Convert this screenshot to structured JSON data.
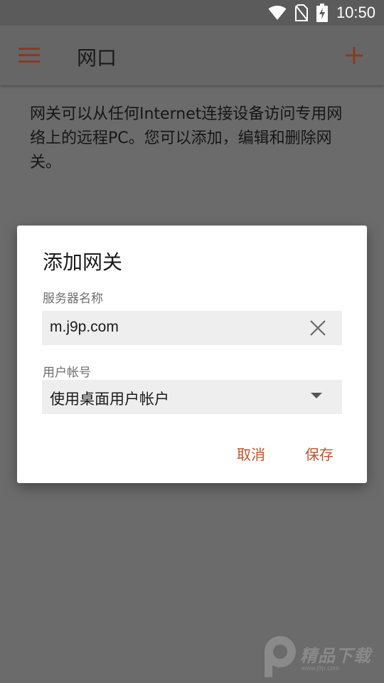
{
  "status_bar": {
    "time": "10:50",
    "icons": [
      "wifi-icon",
      "no-sim-icon",
      "battery-charging-icon"
    ]
  },
  "app_bar": {
    "title": "网口",
    "menu_icon": "hamburger-menu-icon",
    "add_icon": "plus-icon"
  },
  "main": {
    "description": "网关可以从任何Internet连接设备访问专用网络上的远程PC。您可以添加，编辑和删除网关。"
  },
  "dialog": {
    "title": "添加网关",
    "server_name": {
      "label": "服务器名称",
      "value": "m.j9p.com",
      "clear_icon": "close-icon"
    },
    "user_account": {
      "label": "用户帐号",
      "selected": "使用桌面用户帐户"
    },
    "cancel_label": "取消",
    "save_label": "保存"
  },
  "watermark": {
    "text": "精品下载",
    "subtext": "www.j9p.com"
  },
  "colors": {
    "accent": "#c4502b",
    "scrim_background": "#6b6b6b",
    "dialog_background": "#ffffff",
    "field_background": "#eeeeee"
  }
}
